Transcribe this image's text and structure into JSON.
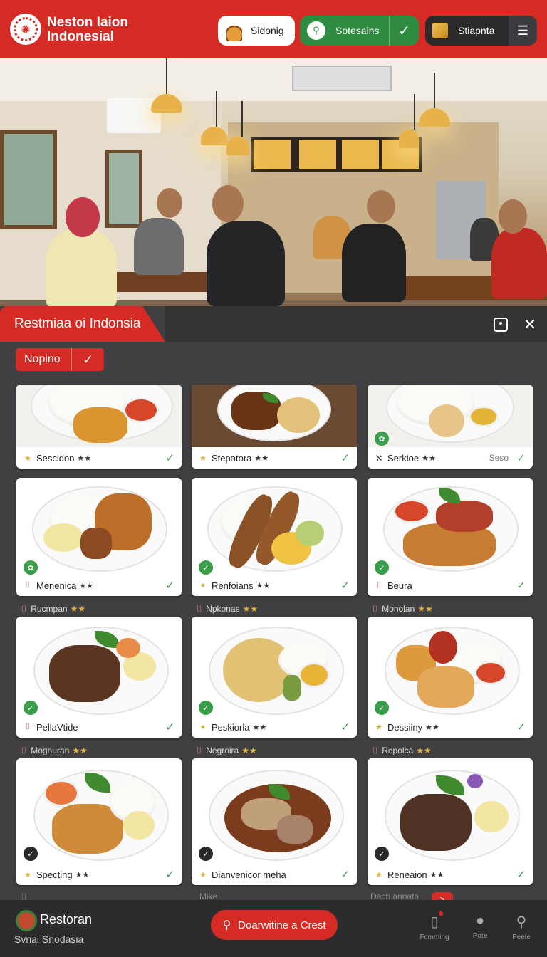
{
  "header": {
    "brand_line1": "Neston Iaion",
    "brand_line2": "Indonesial",
    "btn1_label": "Sidonig",
    "btn2_label": "Sotesains",
    "btn3_label": "Stiapnta"
  },
  "section": {
    "title": "Restmiaa oi Indonsia",
    "filter_label": "Nopino"
  },
  "rows": [
    {
      "category_labels": [],
      "cards": [
        {
          "label": "Sescidon",
          "stars": "★★",
          "subtext": ""
        },
        {
          "label": "Stepatora",
          "stars": "★★",
          "subtext": ""
        },
        {
          "label": "Serkioe",
          "stars": "★★",
          "subtext": "Seso"
        }
      ]
    },
    {
      "category_labels": [],
      "cards": [
        {
          "label": "Menenica",
          "stars": "★★",
          "subtext": ""
        },
        {
          "label": "Renfoians",
          "stars": "★★",
          "subtext": ""
        },
        {
          "label": "Beura",
          "stars": "",
          "subtext": ""
        }
      ]
    },
    {
      "category_labels": [
        "Rucmpan",
        "Npkonas",
        "Monolan"
      ],
      "cards": [
        {
          "label": "PellaVtide",
          "stars": "",
          "subtext": ""
        },
        {
          "label": "Peskiorla",
          "stars": "★★",
          "subtext": ""
        },
        {
          "label": "Dessiiny",
          "stars": "★★",
          "subtext": ""
        }
      ]
    },
    {
      "category_labels": [
        "Mognuran",
        "Negroira",
        "Repolca"
      ],
      "cards": [
        {
          "label": "Specting",
          "stars": "★★",
          "subtext": ""
        },
        {
          "label": "Dianvenicor meha",
          "stars": "",
          "subtext": ""
        },
        {
          "label": "Reneaion",
          "stars": "★★",
          "subtext": ""
        }
      ]
    }
  ],
  "peek_labels": [
    "Mike",
    "Dach annata"
  ],
  "peek_badge": ">",
  "bottom_bar": {
    "name": "Restoran",
    "subtitle": "Svnai Snodasia",
    "cta_label": "Doarwitine a Crest",
    "nav": [
      {
        "label": "Fcmming",
        "icon": "clipboard-icon"
      },
      {
        "label": "Pote",
        "icon": "profile-icon"
      },
      {
        "label": "Peele",
        "icon": "search-icon"
      }
    ]
  },
  "colors": {
    "brand_red": "#d62b25",
    "green": "#2e8b3f",
    "dark": "#2a2a2c",
    "check_green": "#3a9d4a"
  }
}
